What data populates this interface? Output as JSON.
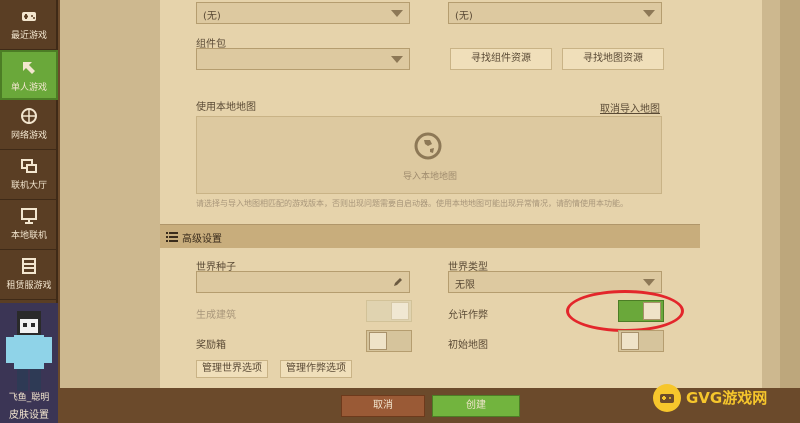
{
  "sidebar": {
    "items": [
      {
        "label": "最近游戏",
        "icon": "gamepad-icon"
      },
      {
        "label": "单人游戏",
        "icon": "cursor-arrow-icon",
        "active": true
      },
      {
        "label": "网络游戏",
        "icon": "network-icon"
      },
      {
        "label": "联机大厅",
        "icon": "lobby-icon"
      },
      {
        "label": "本地联机",
        "icon": "monitor-icon"
      },
      {
        "label": "租赁服游戏",
        "icon": "server-rack-icon"
      }
    ],
    "avatar_name": "飞鱼_聪明",
    "skin_settings": "皮肤设置"
  },
  "form": {
    "dropdown_left_value": "(无)",
    "dropdown_right_value": "(无)",
    "component_pack_label": "组件包",
    "find_component_button": "寻找组件资源",
    "find_map_button": "寻找地图资源",
    "use_local_map_label": "使用本地地图",
    "cancel_import_link": "取消导入地图",
    "import_local_map": "导入本地地图",
    "hint_text": "请选择与导入地图相匹配的游戏版本，否则出现问题需要自启动器。使用本地地图可能出现异常情况，请酌情使用本功能。"
  },
  "advanced": {
    "title": "高级设置",
    "world_seed_label": "世界种子",
    "world_type_label": "世界类型",
    "world_type_value": "无限",
    "generate_structures_label": "生成建筑",
    "allow_cheats_label": "允许作弊",
    "bonus_chest_label": "奖励箱",
    "starting_map_label": "初始地图",
    "manage_world_options_button": "管理世界选项",
    "manage_cheat_options_button": "管理作弊选项",
    "toggles": {
      "generate_structures": "on-disabled",
      "allow_cheats": "on",
      "bonus_chest": "off",
      "starting_map": "off"
    }
  },
  "footer": {
    "cancel": "取消",
    "create": "创建"
  },
  "watermark": "GVG游戏网",
  "colors": {
    "accent_green": "#6aa83a",
    "cancel_brown": "#9a5a36",
    "highlight_red": "#e3262b"
  }
}
